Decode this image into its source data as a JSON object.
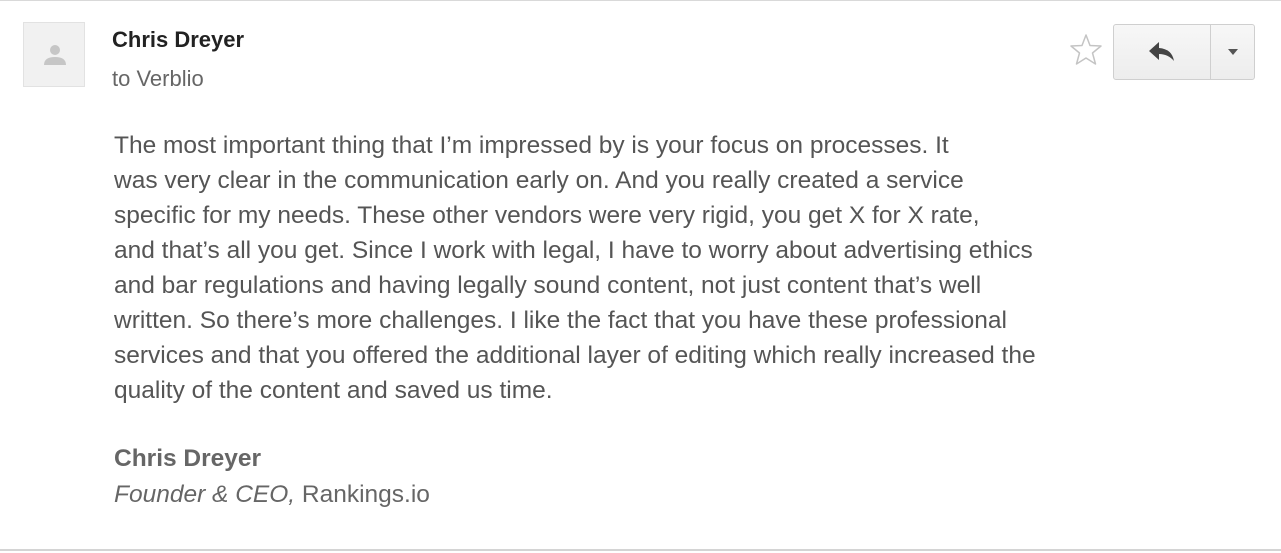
{
  "message": {
    "sender_name": "Chris Dreyer",
    "recipient_line": "to Verblio",
    "body": [
      "The most important thing that I’m impressed by is your focus on processes. It",
      "was very clear in the communication early on. And you really created a service",
      "specific for my needs. These other vendors were very rigid, you get X for X rate,",
      "and that’s all you get. Since I work with legal, I have to worry about advertising ethics",
      "and bar regulations and having legally sound content, not just content that’s well",
      "written. So there’s more challenges. I like the fact that you have these professional",
      "services and that you offered the additional layer of editing which really increased the",
      "quality of the content and saved us time."
    ],
    "signature": {
      "name": "Chris Dreyer",
      "role": "Founder & CEO,",
      "company": "Rankings.io"
    }
  },
  "actions": {
    "star_icon": "star-outline-icon",
    "reply_icon": "reply-arrow-icon",
    "more_icon": "caret-down-icon"
  },
  "colors": {
    "text_dark": "#222222",
    "text_body": "#555555",
    "text_muted": "#666666",
    "button_bg": "#f2f2f2",
    "border": "#cfcfcf"
  }
}
